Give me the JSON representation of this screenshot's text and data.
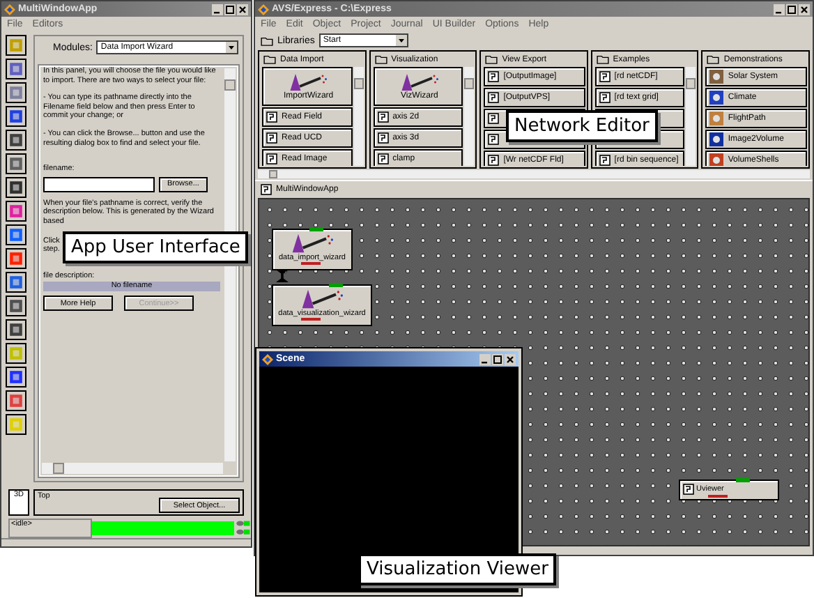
{
  "app_window": {
    "title": "MultiWindowApp",
    "menu": [
      "File",
      "Editors"
    ],
    "modules_label": "Modules:",
    "module": "Data Import Wizard",
    "paragraphs": [
      "In this panel, you will choose the file you would like to import. There are two ways to select your file:",
      "- You can type its pathname directly into the Filename field below and then press Enter to commit your change; or",
      "- You can click the Browse... button and use the resulting dialog box to find and select your file."
    ],
    "filename_label": "filename:",
    "browse_button": "Browse...",
    "verify_text": "When your file's pathname is correct, verify the description below. This is generated by the Wizard based",
    "click_text": "Click",
    "step_text": "step.",
    "description_label": "file description:",
    "description_value": "No filename",
    "buttons": [
      {
        "label": "More Help",
        "disabled": false
      },
      {
        "label": "Continue>>",
        "disabled": true
      }
    ],
    "view_mode": "3D",
    "view_name": "Top",
    "select_button": "Select Object...",
    "status": "<idle>",
    "progress": {
      "level": 1
    }
  },
  "express_window": {
    "title": "AVS/Express - C:\\Express",
    "menu": [
      "File",
      "Edit",
      "Object",
      "Project",
      "Journal",
      "UI Builder",
      "Options",
      "Help"
    ],
    "libraries_label": "Libraries",
    "library": "Start",
    "libraries": [
      {
        "title": "Data Import",
        "items": [
          {
            "kind": "wizard",
            "label": "ImportWizard"
          },
          {
            "kind": "module",
            "label": "Read Field"
          },
          {
            "kind": "module",
            "label": "Read UCD"
          },
          {
            "kind": "module",
            "label": "Read Image"
          }
        ]
      },
      {
        "title": "Visualization",
        "items": [
          {
            "kind": "wizard",
            "label": "VizWizard"
          },
          {
            "kind": "module",
            "label": "axis 2d"
          },
          {
            "kind": "module",
            "label": "axis 3d"
          },
          {
            "kind": "module",
            "label": "clamp"
          }
        ]
      },
      {
        "title": "View Export",
        "items": [
          {
            "kind": "module",
            "label": "[OutputImage]"
          },
          {
            "kind": "module",
            "label": "[OutputVPS]"
          },
          {
            "kind": "module"
          },
          {
            "kind": "module"
          },
          {
            "kind": "module",
            "label": "[Wr netCDF Fld]"
          }
        ]
      },
      {
        "title": "Examples",
        "items": [
          {
            "kind": "module",
            "label": "[rd netCDF]"
          },
          {
            "kind": "module",
            "label": "[rd text grid]"
          },
          {
            "kind": "blank"
          },
          {
            "kind": "blank"
          },
          {
            "kind": "module",
            "label": "[rd bin sequence]"
          }
        ]
      },
      {
        "title": "Demonstrations",
        "items": [
          {
            "kind": "demo",
            "label": "Solar System"
          },
          {
            "kind": "demo",
            "label": "Climate"
          },
          {
            "kind": "demo",
            "label": "FlightPath"
          },
          {
            "kind": "demo",
            "label": "Image2Volume"
          },
          {
            "kind": "demo",
            "label": "VolumeShells"
          }
        ]
      }
    ],
    "network": {
      "title": "MultiWindowApp",
      "nodes": [
        {
          "kind": "wizard",
          "label": "data_import_wizard"
        },
        {
          "kind": "wizard",
          "label": "data_visualization_wizard"
        },
        {
          "kind": "module",
          "label": "Uviewer"
        }
      ]
    }
  },
  "scene_window": {
    "title": "Scene"
  },
  "callouts": [
    "App User Interface",
    "Network Editor",
    "Visualization Viewer"
  ]
}
